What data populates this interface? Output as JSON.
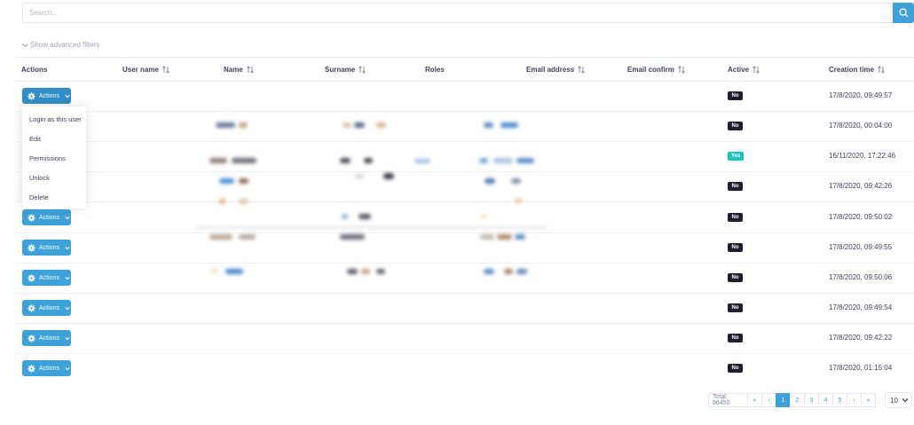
{
  "search": {
    "placeholder": "Search..."
  },
  "filters": {
    "toggle_label": "Show advanced filters"
  },
  "columns": [
    "Actions",
    "User name",
    "Name",
    "Surname",
    "Roles",
    "Email address",
    "Email confirm",
    "Active",
    "Creation time"
  ],
  "actions_label": "Actions",
  "dropdown": [
    "Login as this user",
    "Edit",
    "Permissions",
    "Unlock",
    "Delete"
  ],
  "rows": [
    {
      "active": "No",
      "created": "17/8/2020, 09:49:57"
    },
    {
      "active": "No",
      "created": "17/8/2020, 00:04:00"
    },
    {
      "active": "Yes",
      "created": "16/11/2020, 17:22:46"
    },
    {
      "active": "No",
      "created": "17/8/2020, 09:42:26"
    },
    {
      "active": "No",
      "created": "17/8/2020, 09:50:02"
    },
    {
      "active": "No",
      "created": "17/8/2020, 09:49:55"
    },
    {
      "active": "No",
      "created": "17/8/2020, 09:50:06"
    },
    {
      "active": "No",
      "created": "17/8/2020, 09:49:54"
    },
    {
      "active": "No",
      "created": "17/8/2020, 09:42:22"
    },
    {
      "active": "No",
      "created": "17/8/2020, 01:15:04"
    }
  ],
  "pagination": {
    "total": "Total: 86450",
    "first": "«",
    "prev": "‹",
    "pages": [
      "1",
      "2",
      "3",
      "4",
      "5"
    ],
    "current_page": "1",
    "next": "›",
    "last": "»",
    "page_size": "10"
  },
  "colors": {
    "accent": "#3da1da",
    "badge_no": "#1e1e2d",
    "badge_yes": "#1bc5bd"
  },
  "icons": {
    "search": "search-icon",
    "filter_toggle": "chevron-down-icon",
    "sort": "sort-icon",
    "action": "gear-icon",
    "action_caret": "chevron-down-icon",
    "page_size_caret": "chevron-down-icon"
  }
}
